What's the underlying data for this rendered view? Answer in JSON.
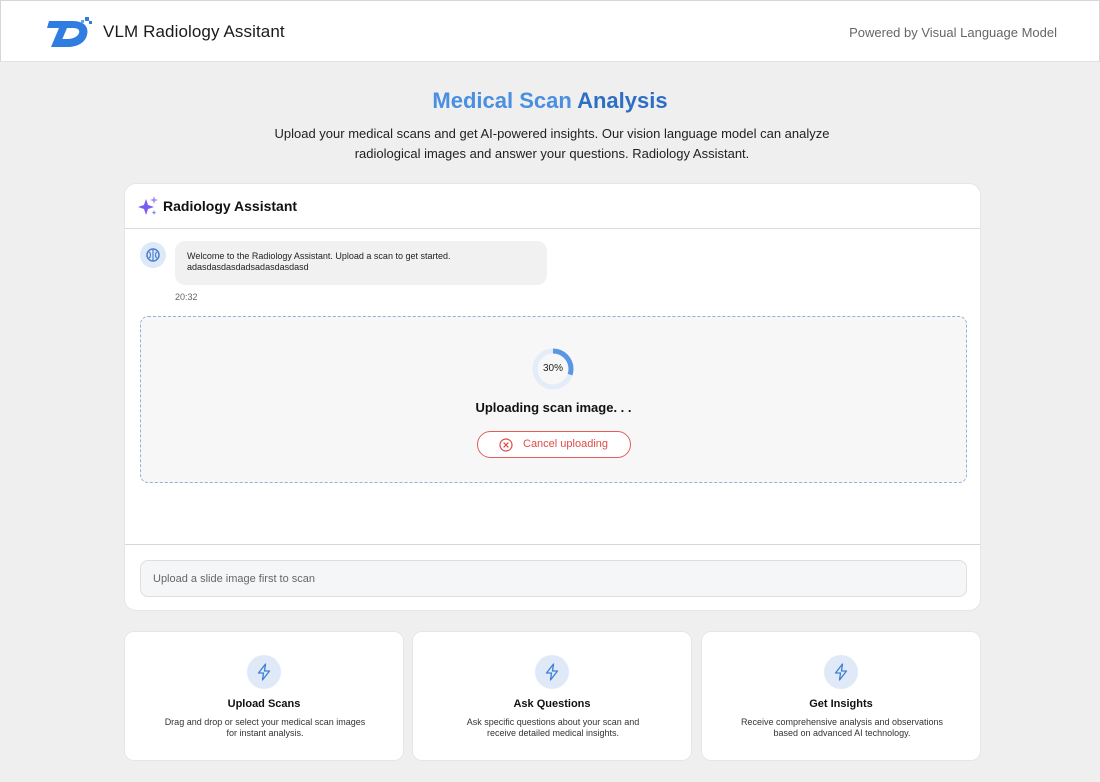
{
  "header": {
    "app_title": "VLM Radiology Assitant",
    "powered_by": "Powered by Visual Language Model"
  },
  "hero": {
    "title_part1": "Medical Scan ",
    "title_part2": "Analysis",
    "subtitle": "Upload your medical scans and get AI-powered insights. Our vision language model can analyze radiological images and answer your questions. Radiology Assistant."
  },
  "chat": {
    "title": "Radiology Assistant",
    "message_line1": "Welcome to the Radiology Assistant. Upload a scan to get started.",
    "message_line2": "adasdasdasdadsadasdasdasd",
    "message_time": "20:32",
    "upload": {
      "progress_percent": 30,
      "progress_label": "30%",
      "status": "Uploading scan image. . .",
      "cancel_label": "Cancel uploading"
    },
    "input_placeholder": "Upload a slide image first to scan"
  },
  "features": [
    {
      "icon": "lightning-icon",
      "title": "Upload Scans",
      "desc_line1": "Drag and drop or select your medical scan images",
      "desc_line2": "for instant analysis."
    },
    {
      "icon": "lightning-icon",
      "title": "Ask Questions",
      "desc_line1": "Ask specific questions about your scan and",
      "desc_line2": "receive detailed medical insights."
    },
    {
      "icon": "lightning-icon",
      "title": "Get Insights",
      "desc_line1": "Receive comprehensive analysis and observations",
      "desc_line2": "based on advanced AI technology."
    }
  ],
  "colors": {
    "accent_blue": "#4a8fe0",
    "accent_dark_blue": "#2e6fc4",
    "cancel_red": "#e35d5d",
    "page_bg": "#efefef"
  }
}
